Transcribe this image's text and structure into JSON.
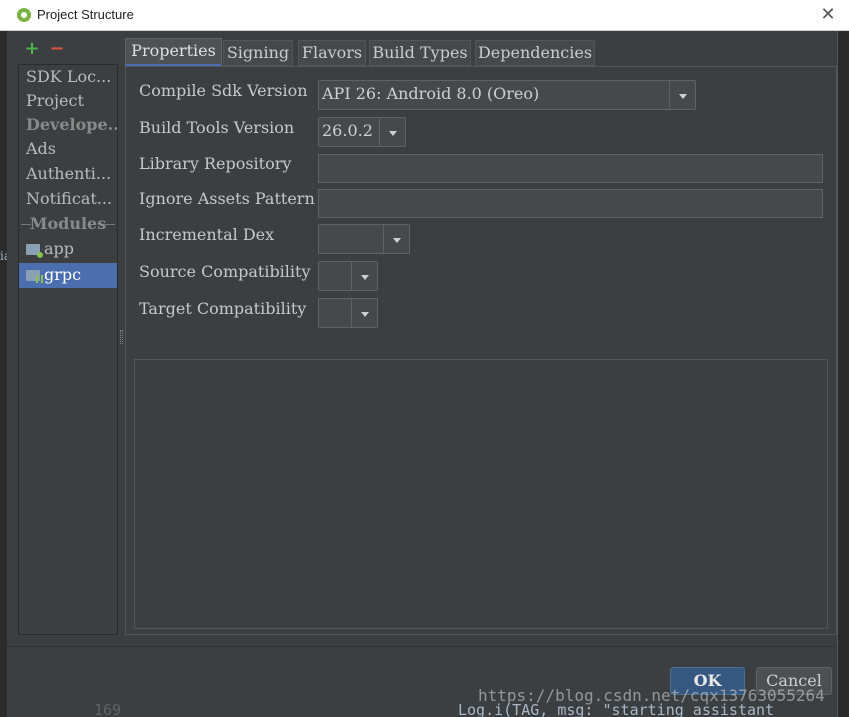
{
  "window": {
    "title": "Project Structure"
  },
  "toolbar": {
    "add": "+",
    "remove": "−"
  },
  "sidebar": {
    "items": [
      {
        "label": "SDK Loc..."
      },
      {
        "label": "Project"
      },
      {
        "label": "Develope..."
      },
      {
        "label": "Ads"
      },
      {
        "label": "Authenti..."
      },
      {
        "label": "Notificat..."
      },
      {
        "label": "Modules"
      },
      {
        "label": "app"
      },
      {
        "label": "grpc"
      }
    ]
  },
  "tabs": [
    "Properties",
    "Signing",
    "Flavors",
    "Build Types",
    "Dependencies"
  ],
  "form": {
    "compile_sdk": {
      "label": "Compile Sdk Version",
      "value": "API 26: Android 8.0 (Oreo)"
    },
    "build_tools": {
      "label": "Build Tools Version",
      "value": "26.0.2"
    },
    "library_repo": {
      "label": "Library Repository",
      "value": ""
    },
    "ignore_assets": {
      "label": "Ignore Assets Pattern",
      "value": ""
    },
    "incremental_dex": {
      "label": "Incremental Dex",
      "value": ""
    },
    "source_compat": {
      "label": "Source Compatibility",
      "value": ""
    },
    "target_compat": {
      "label": "Target Compatibility",
      "value": ""
    }
  },
  "buttons": {
    "ok": "OK",
    "cancel": "Cancel"
  },
  "watermark": "https://blog.csdn.net/cqx13763055264",
  "background_code": {
    "line_number": "169",
    "text": "Log.i(TAG, msg: \"starting assistant"
  },
  "background_edge": "ia",
  "colors": {
    "selection": "#4b6eaf",
    "panel": "#3c3f41",
    "add": "#4caf50",
    "remove": "#d9533f"
  }
}
